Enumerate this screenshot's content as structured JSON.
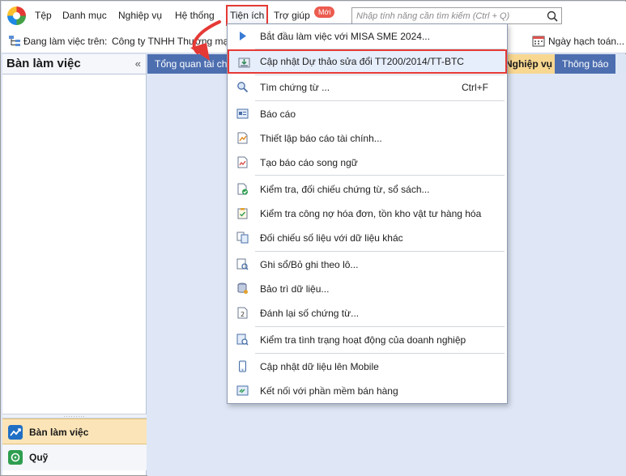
{
  "menubar": {
    "items": [
      {
        "label": "Tệp"
      },
      {
        "label": "Danh mục"
      },
      {
        "label": "Nghiệp vụ"
      },
      {
        "label": "Hệ thống"
      },
      {
        "label": "Tiện ích"
      },
      {
        "label": "Trợ giúp"
      }
    ],
    "new_badge": "Mới",
    "search_placeholder": "Nhập tính năng cần tìm kiếm (Ctrl + Q)"
  },
  "toolbar": {
    "workspace_label": "Đang làm việc trên:",
    "workspace_value": "Công ty TNHH Thương mại",
    "date_label": "Ngày hạch toán..."
  },
  "left_panel": {
    "title": "Bàn làm việc",
    "collapse": "«",
    "nav": [
      {
        "label": "Bàn làm việc"
      },
      {
        "label": "Quỹ"
      }
    ]
  },
  "tabs": [
    {
      "label": "Tổng quan tài chính"
    },
    {
      "label": "Nghiệp vụ"
    },
    {
      "label": "Thông báo"
    }
  ],
  "dropdown": {
    "items": [
      {
        "label": "Bắt đầu làm việc với MISA SME 2024...",
        "shortcut": ""
      },
      {
        "label": "Cập nhật Dự thảo sửa đổi TT200/2014/TT-BTC",
        "shortcut": ""
      },
      {
        "label": "Tìm chứng từ ...",
        "shortcut": "Ctrl+F"
      },
      {
        "label": "Báo cáo",
        "shortcut": ""
      },
      {
        "label": "Thiết lập báo cáo tài chính...",
        "shortcut": ""
      },
      {
        "label": "Tạo báo cáo song ngữ",
        "shortcut": ""
      },
      {
        "label": "Kiểm tra, đối chiếu chứng từ, sổ sách...",
        "shortcut": ""
      },
      {
        "label": "Kiểm tra công nợ hóa đơn, tồn kho vật tư hàng hóa",
        "shortcut": ""
      },
      {
        "label": "Đối chiếu số liệu với dữ liệu khác",
        "shortcut": ""
      },
      {
        "label": "Ghi sổ/Bỏ ghi theo lô...",
        "shortcut": ""
      },
      {
        "label": "Bảo trì dữ liệu...",
        "shortcut": ""
      },
      {
        "label": "Đánh lại số chứng từ...",
        "shortcut": ""
      },
      {
        "label": "Kiểm tra tình trạng hoạt động của doanh nghiệp",
        "shortcut": ""
      },
      {
        "label": "Cập nhật dữ liệu lên Mobile",
        "shortcut": ""
      },
      {
        "label": "Kết nối với phần mềm bán hàng",
        "shortcut": ""
      }
    ]
  },
  "colors": {
    "highlight_border": "#e53935",
    "tab_blue": "#4d6fb0",
    "tab_active": "#f8d791",
    "nav_selected": "#fbe4b7"
  }
}
